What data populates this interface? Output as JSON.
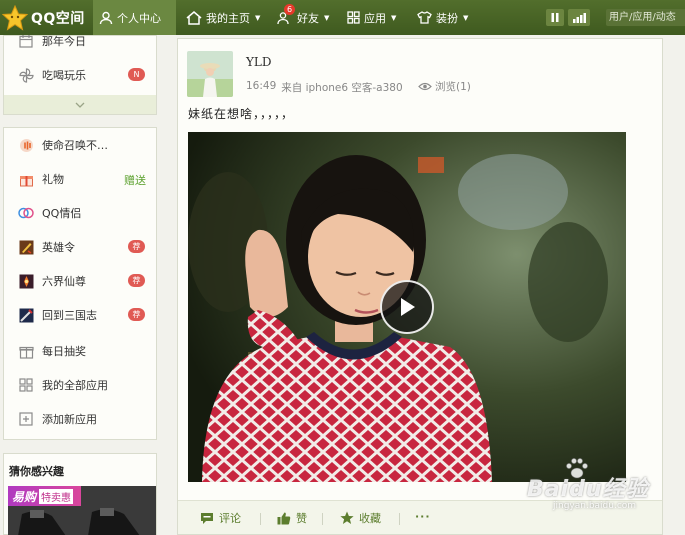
{
  "topbar": {
    "logo_text": "QQ空间",
    "nav": [
      {
        "label": "个人中心",
        "icon": "user-icon",
        "active": true
      },
      {
        "label": "我的主页",
        "icon": "home-icon",
        "dropdown": true
      },
      {
        "label": "好友",
        "icon": "friends-icon",
        "dropdown": true,
        "badge": "6"
      },
      {
        "label": "应用",
        "icon": "apps-grid-icon",
        "dropdown": true
      },
      {
        "label": "装扮",
        "icon": "shirt-icon",
        "dropdown": true
      }
    ],
    "search_placeholder": "用户/应用/动态"
  },
  "sidebar": {
    "top_items": [
      {
        "label": "那年今日",
        "icon": "calendar-icon"
      },
      {
        "label": "吃喝玩乐",
        "icon": "pinwheel-icon",
        "tag": "N"
      }
    ],
    "app_items": [
      {
        "label": "使命召唤不…",
        "icon": "sound-icon"
      },
      {
        "label": "礼物",
        "icon": "gift-icon",
        "tag": "赠送"
      },
      {
        "label": "QQ情侣",
        "icon": "couple-icon"
      },
      {
        "label": "英雄令",
        "icon": "hero-icon",
        "tag": "荐"
      },
      {
        "label": "六界仙尊",
        "icon": "fairy-icon",
        "tag": "荐"
      },
      {
        "label": "回到三国志",
        "icon": "sanguo-icon",
        "tag": "荐"
      },
      {
        "label": "每日抽奖",
        "icon": "present-icon"
      },
      {
        "label": "我的全部应用",
        "icon": "all-apps-icon"
      },
      {
        "label": "添加新应用",
        "icon": "plus-icon"
      }
    ],
    "guess_title": "猜你感兴趣",
    "promo": {
      "brand": "易购",
      "tag": "特卖惠"
    }
  },
  "post": {
    "username": "YLD",
    "time": "16:49",
    "source": "来自 iphone6 空客-a380",
    "views": "浏览(1)",
    "text": "妹纸在想啥，，，，，",
    "actions": [
      {
        "label": "评论",
        "icon": "comment-icon"
      },
      {
        "label": "赞",
        "icon": "thumbs-up-icon"
      },
      {
        "label": "收藏",
        "icon": "star-icon"
      },
      {
        "label": "···",
        "icon": "more-icon"
      }
    ]
  },
  "watermark": {
    "main": "Baidu经验",
    "sub": "jingyan.baidu.com"
  },
  "colors": {
    "topbar": "#4a6527",
    "accent": "#5c7d2e",
    "tag_red": "#e05a54",
    "gift_green": "#5aa02c"
  }
}
